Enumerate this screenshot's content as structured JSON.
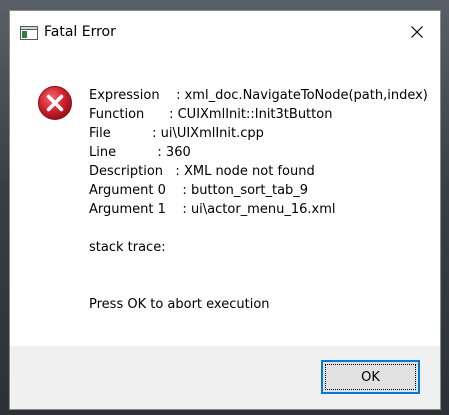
{
  "window": {
    "title": "Fatal Error",
    "icon": "window-app-icon",
    "close_icon": "close-icon"
  },
  "message": {
    "icon": "error-icon",
    "lines": [
      "Expression    : xml_doc.NavigateToNode(path,index)",
      "Function      : CUIXmlInit::Init3tButton",
      "File          : ui\\UIXmlInit.cpp",
      "Line          : 360",
      "Description   : XML node not found",
      "Argument 0    : button_sort_tab_9",
      "Argument 1    : ui\\actor_menu_16.xml"
    ],
    "stack_trace_label": "stack trace:",
    "prompt": "Press OK to abort execution"
  },
  "buttons": {
    "ok_label": "OK"
  },
  "colors": {
    "error_red": "#d3212d",
    "focus_blue": "#0078d7",
    "footer_bg": "#f0f0f0"
  }
}
